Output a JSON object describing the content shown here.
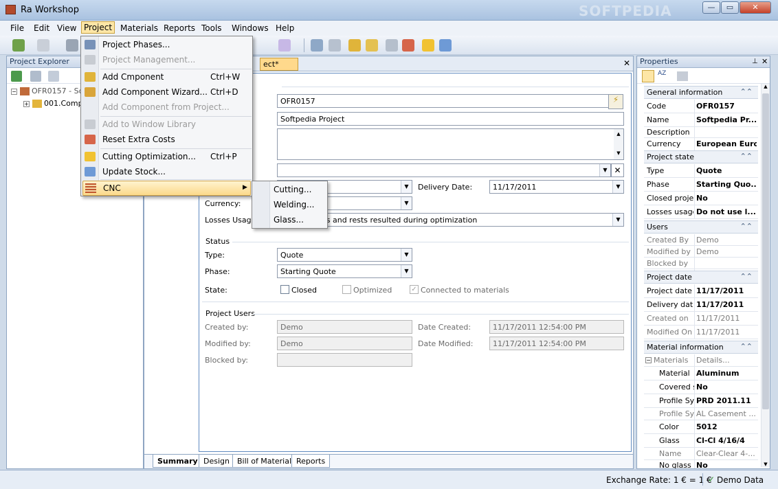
{
  "window": {
    "title": "Ra Workshop",
    "watermark": "SOFTPEDIA"
  },
  "menubar": [
    "File",
    "Edit",
    "View",
    "Project",
    "Materials",
    "Reports",
    "Tools",
    "Windows",
    "Help"
  ],
  "explorer": {
    "title": "Project Explorer",
    "root": "OFR0157 - So",
    "child": "001.Comp"
  },
  "document": {
    "tab": "ect*",
    "section_label": "nation",
    "code_value": "OFR0157",
    "name_value": "Softpedia Project",
    "delivery_label": "Delivery Date:",
    "delivery_value": "11/17/2011",
    "currency_label": "Currency:",
    "losses_label": "Losses Usage",
    "losses_value": "es and rests resulted during optimization",
    "status": {
      "title": "Status",
      "type_label": "Type:",
      "type_value": "Quote",
      "phase_label": "Phase:",
      "phase_value": "Starting Quote",
      "state_label": "State:",
      "closed": "Closed",
      "optimized": "Optimized",
      "connected": "Connected to materials"
    },
    "users": {
      "title": "Project Users",
      "created_by_label": "Created by:",
      "created_by": "Demo",
      "modified_by_label": "Modified by:",
      "modified_by": "Demo",
      "blocked_by_label": "Blocked by:",
      "date_created_label": "Date Created:",
      "date_created": "11/17/2011 12:54:00 PM",
      "date_modified_label": "Date Modified:",
      "date_modified": "11/17/2011 12:54:00 PM"
    },
    "bottom_tabs": [
      "Summary",
      "Design",
      "Bill of Material",
      "Reports"
    ]
  },
  "properties": {
    "title": "Properties",
    "sections": {
      "general": "General information",
      "state": "Project state",
      "users": "Users",
      "date": "Project date",
      "material": "Material information"
    },
    "rows": {
      "code": [
        "Code",
        "OFR0157"
      ],
      "name": [
        "Name",
        "Softpedia Pr..."
      ],
      "description": [
        "Description",
        ""
      ],
      "currency": [
        "Currency",
        "European Euro"
      ],
      "type": [
        "Type",
        "Quote"
      ],
      "phase": [
        "Phase",
        "Starting Quo..."
      ],
      "closed": [
        "Closed proje",
        "No"
      ],
      "losses": [
        "Losses usage",
        "Do not use l..."
      ],
      "created_by": [
        "Created By",
        "Demo"
      ],
      "modified_by": [
        "Modified by",
        "Demo"
      ],
      "blocked_by": [
        "Blocked by",
        ""
      ],
      "project_date": [
        "Project date",
        "11/17/2011"
      ],
      "delivery_date": [
        "Delivery dat",
        "11/17/2011"
      ],
      "created_on": [
        "Created on",
        "11/17/2011"
      ],
      "modified_on": [
        "Modified On",
        "11/17/2011"
      ],
      "materials": [
        "Materials",
        "Details..."
      ],
      "material": [
        "Material",
        "Aluminum"
      ],
      "covered": [
        "Covered s",
        "No"
      ],
      "profile_sys": [
        "Profile Sys",
        "PRD 2011.11"
      ],
      "profile_sys2": [
        "Profile Sys",
        "AL Casement ..."
      ],
      "color": [
        "Color",
        "5012"
      ],
      "glass": [
        "Glass",
        "Cl-Cl 4/16/4"
      ],
      "gname": [
        "Name",
        "Clear-Clear 4-..."
      ],
      "noglass": [
        "No glass",
        "No"
      ]
    }
  },
  "menu": {
    "project_phases": "Project Phases...",
    "project_management": "Project Management...",
    "add_component": "Add Cmponent",
    "add_component_sc": "Ctrl+W",
    "add_wizard": "Add Component Wizard...",
    "add_wizard_sc": "Ctrl+D",
    "add_from_project": "Add Component from Project...",
    "add_to_library": "Add to Window Library",
    "reset_costs": "Reset Extra Costs",
    "cutting_opt": "Cutting Optimization...",
    "cutting_opt_sc": "Ctrl+P",
    "update_stock": "Update Stock...",
    "cnc": "CNC",
    "cnc_sub": [
      "Cutting...",
      "Welding...",
      "Glass..."
    ]
  },
  "statusbar": {
    "exchange": "Exchange Rate: 1 € = 1 €",
    "demo": "Demo Data"
  },
  "colors": {
    "accent": "#fde6a6",
    "frame": "#5f8ac0"
  }
}
